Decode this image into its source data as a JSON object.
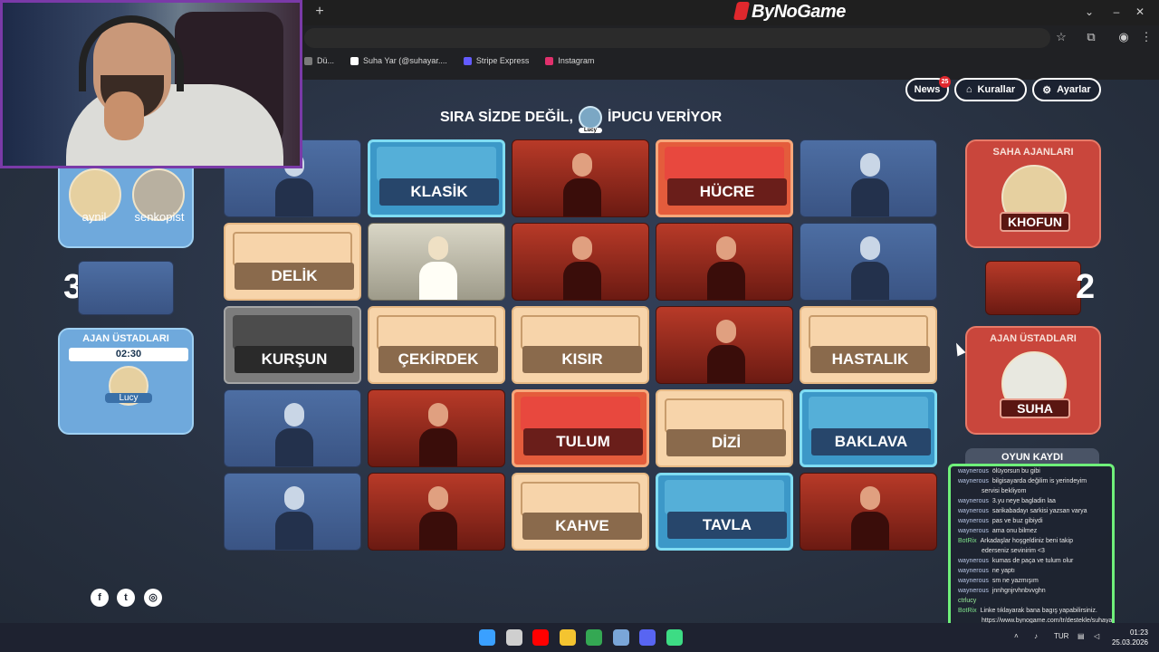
{
  "browser": {
    "brand": "ByNoGame",
    "new_tab_symbol": "+",
    "bookmarks": [
      {
        "label": "Dü...",
        "icon": "bookmark-generic-icon",
        "color": "#7a7a7a"
      },
      {
        "label": "Suha Yar (@suhayar....",
        "icon": "tiktok-icon",
        "color": "#ffffff"
      },
      {
        "label": "Stripe Express",
        "icon": "stripe-icon",
        "color": "#635bff"
      },
      {
        "label": "Instagram",
        "icon": "instagram-icon",
        "color": "#e1306c"
      }
    ]
  },
  "header": {
    "news_label": "News",
    "news_badge": "25",
    "rules_label": "Kurallar",
    "settings_label": "Ayarlar",
    "turn_prefix": "SIRA SİZDE DEĞİL,",
    "turn_suffix": "İPUCU VERİYOR",
    "turn_avatar_name": "Lucy"
  },
  "blue_team": {
    "operatives": [
      "aynil",
      "senkopist"
    ],
    "score": "3",
    "spymaster_title": "AJAN ÜSTADLARI",
    "timer": "02:30",
    "spymaster_name": "Lucy"
  },
  "red_team": {
    "operatives_title": "SAHA AJANLARI",
    "operatives_name": "KHOFUN",
    "score": "2",
    "spymaster_title": "AJAN ÜSTADLARI",
    "spymaster_name": "SUHA"
  },
  "board": {
    "cards": [
      {
        "type": "agent-blue",
        "word": ""
      },
      {
        "type": "blue",
        "word": "KLASİK"
      },
      {
        "type": "agent-red",
        "word": ""
      },
      {
        "type": "red",
        "word": "HÜCRE"
      },
      {
        "type": "agent-blue",
        "word": ""
      },
      {
        "type": "neutral",
        "word": "DELİK"
      },
      {
        "type": "agent-tan",
        "word": ""
      },
      {
        "type": "agent-red",
        "word": ""
      },
      {
        "type": "agent-red",
        "word": ""
      },
      {
        "type": "agent-blue",
        "word": ""
      },
      {
        "type": "black",
        "word": "KURŞUN"
      },
      {
        "type": "neutral",
        "word": "ÇEKİRDEK"
      },
      {
        "type": "neutral",
        "word": "KISIR"
      },
      {
        "type": "agent-red",
        "word": ""
      },
      {
        "type": "neutral",
        "word": "HASTALIK"
      },
      {
        "type": "agent-blue",
        "word": ""
      },
      {
        "type": "agent-red",
        "word": ""
      },
      {
        "type": "red",
        "word": "TULUM"
      },
      {
        "type": "neutral",
        "word": "DİZİ"
      },
      {
        "type": "blue",
        "word": "BAKLAVA"
      },
      {
        "type": "agent-blue",
        "word": ""
      },
      {
        "type": "agent-red",
        "word": ""
      },
      {
        "type": "neutral",
        "word": "KAHVE"
      },
      {
        "type": "blue",
        "word": "TAVLA"
      },
      {
        "type": "agent-red",
        "word": ""
      }
    ]
  },
  "game_log": {
    "title": "OYUN KAYDI"
  },
  "chat": [
    {
      "user": "waynerous",
      "text": "ölüyorsun bu gibi",
      "kind": "user"
    },
    {
      "user": "waynerous",
      "text": "bilgisayarda değilim is yerindeyim",
      "kind": "user"
    },
    {
      "user": "",
      "text": "servisi bekliyom",
      "kind": "cont"
    },
    {
      "user": "waynerous",
      "text": "3.yu neye bagladin laa",
      "kind": "user"
    },
    {
      "user": "waynerous",
      "text": "sarikabadayı sarkisi yazsan varya",
      "kind": "user"
    },
    {
      "user": "waynerous",
      "text": "pas ve buz gibiydi",
      "kind": "user"
    },
    {
      "user": "waynerous",
      "text": "ama onu bilmez",
      "kind": "user"
    },
    {
      "user": "BotRix",
      "text": "Arkadaşlar hoşgeldiniz beni takip",
      "kind": "bot"
    },
    {
      "user": "",
      "text": "ederseniz sevinirim <3",
      "kind": "cont"
    },
    {
      "user": "waynerous",
      "text": "kumas de paça ve tulum olur",
      "kind": "user"
    },
    {
      "user": "waynerous",
      "text": "ne yaptı",
      "kind": "user"
    },
    {
      "user": "waynerous",
      "text": "sm ne yazmışım",
      "kind": "user"
    },
    {
      "user": "waynerous",
      "text": "jnnhgnjrvhnbvvghn",
      "kind": "user"
    },
    {
      "user": "ctrlucy",
      "text": "",
      "kind": "bot2"
    },
    {
      "user": "BotRix",
      "text": "Linke tıklayarak bana bagış yapabilirsiniz.",
      "kind": "bot"
    },
    {
      "user": "",
      "text": "https://www.bynogame.com/tr/destekle/suhayar",
      "kind": "cont"
    }
  ],
  "taskbar": {
    "lang": "TUR",
    "time": "01:23",
    "date": "25.03.2026",
    "apps": [
      {
        "icon": "windows-start-icon",
        "color": "#3aa0ff"
      },
      {
        "icon": "speedometer-icon",
        "color": "#cfcfcf"
      },
      {
        "icon": "youtube-icon",
        "color": "#ff0000"
      },
      {
        "icon": "folder-icon",
        "color": "#f4c430"
      },
      {
        "icon": "chrome-icon",
        "color": "#34a853"
      },
      {
        "icon": "settings-app-icon",
        "color": "#7aa6d8"
      },
      {
        "icon": "discord-icon",
        "color": "#5865f2"
      },
      {
        "icon": "chat-app-icon",
        "color": "#3ddc84"
      }
    ]
  },
  "colors": {
    "accent_red": "#e0282d",
    "blue_panel": "#6fa9dc",
    "red_panel": "#c9463c",
    "chat_border": "#6ff07a"
  }
}
